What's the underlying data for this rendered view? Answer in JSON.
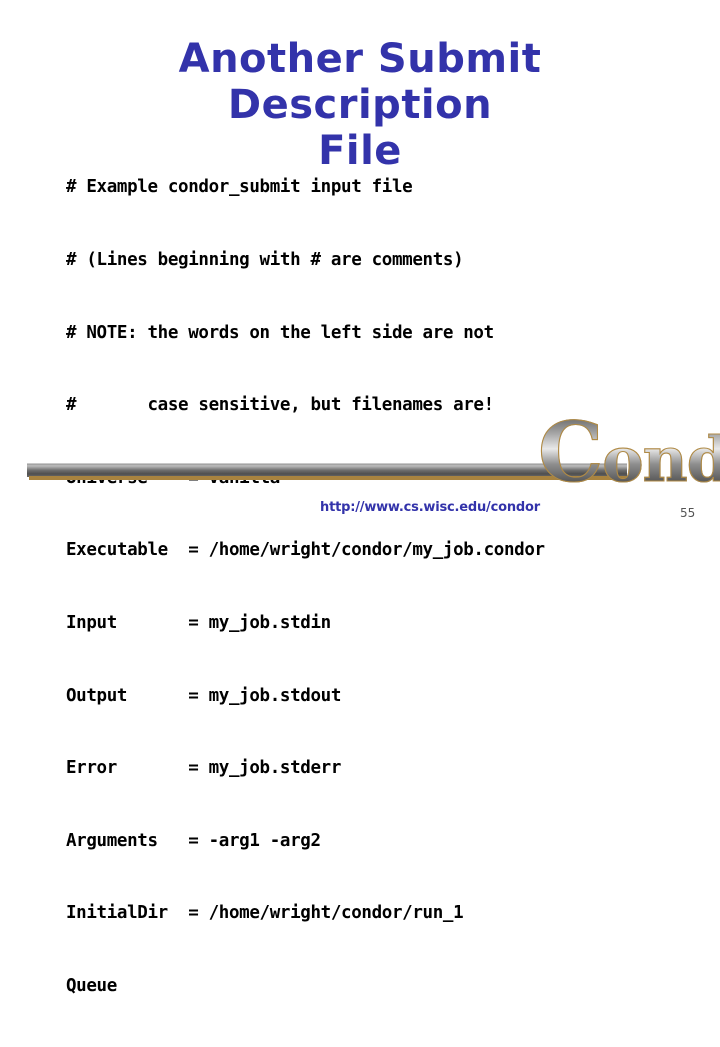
{
  "slide": {
    "title": "Another Submit Description\nFile",
    "title_color": "#3333AA",
    "background_color": "#FFFFFF",
    "number": "55"
  },
  "submit_file": {
    "lines": [
      "# Example condor_submit input file",
      "# (Lines beginning with # are comments)",
      "# NOTE: the words on the left side are not",
      "#       case sensitive, but filenames are!",
      "Universe    = vanilla",
      "Executable  = /home/wright/condor/my_job.condor",
      "Input       = my_job.stdin",
      "Output      = my_job.stdout",
      "Error       = my_job.stderr",
      "Arguments   = -arg1 -arg2",
      "InitialDir  = /home/wright/condor/run_1",
      "Queue"
    ],
    "text_color": "#000000"
  },
  "logo": {
    "cap": "C",
    "rest": "ondor",
    "outline_color": "#B08A44",
    "fill_color": "#8E8E8E"
  },
  "footer": {
    "url": "http://www.cs.wisc.edu/condor",
    "url_color": "#3333AA"
  },
  "decor": {
    "bar_gray": "#6E6E6E",
    "bar_gold": "#A8833F"
  }
}
